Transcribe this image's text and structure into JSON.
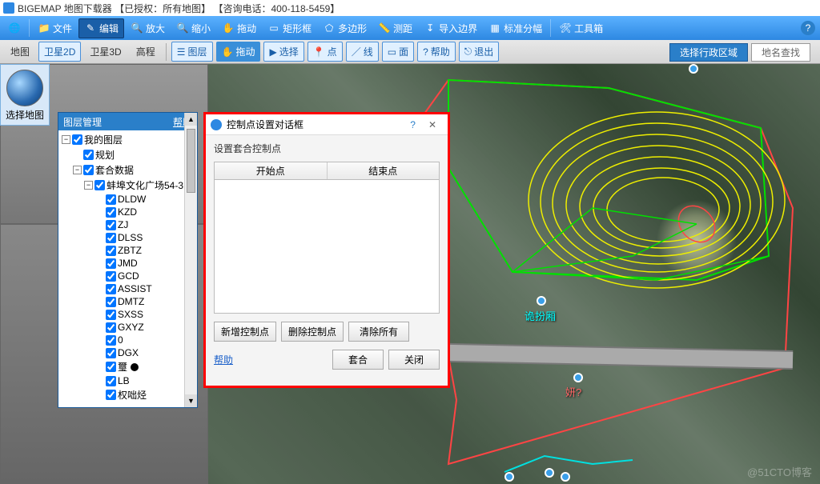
{
  "title": "BIGEMAP 地图下载器 【已授权：所有地图】 【咨询电话：400-118-5459】",
  "toolbar1": {
    "file": "文件",
    "edit": "编辑",
    "zoomin": "放大",
    "zoomout": "缩小",
    "drag": "拖动",
    "rect": "矩形框",
    "poly": "多边形",
    "measure": "测距",
    "import": "导入边界",
    "grid": "标准分幅",
    "toolbox": "工具箱"
  },
  "toolbar2": {
    "map": "地图",
    "sat2d": "卫星2D",
    "sat3d": "卫星3D",
    "elev": "高程",
    "layer": "图层",
    "drag": "拖动",
    "select": "选择",
    "point": "点",
    "line": "线",
    "area": "面",
    "help": "帮助",
    "exit": "退出",
    "region": "选择行政区域",
    "search": "地名查找"
  },
  "leftSelect": "选择地图",
  "layerPanel": {
    "title": "图层管理",
    "help": "帮助",
    "root": "我的图层",
    "n1": "规划",
    "n2": "套合数据",
    "n3": "蚌埠文化广场54-3",
    "leaves": [
      "DLDW",
      "KZD",
      "ZJ",
      "DLSS",
      "ZBTZ",
      "JMD",
      "GCD",
      "ASSIST",
      "DMTZ",
      "SXSS",
      "GXYZ",
      "0",
      "DGX",
      "璽",
      "LB",
      "权咄烃"
    ]
  },
  "dialog": {
    "title": "控制点设置对话框",
    "sub": "设置套合控制点",
    "col1": "开始点",
    "col2": "结束点",
    "add": "新增控制点",
    "del": "删除控制点",
    "clear": "清除所有",
    "help": "帮助",
    "fit": "套合",
    "close": "关闭"
  },
  "markers": {
    "m1": "诡扮厢",
    "m2": "妍?"
  },
  "watermark": "@51CTO博客"
}
